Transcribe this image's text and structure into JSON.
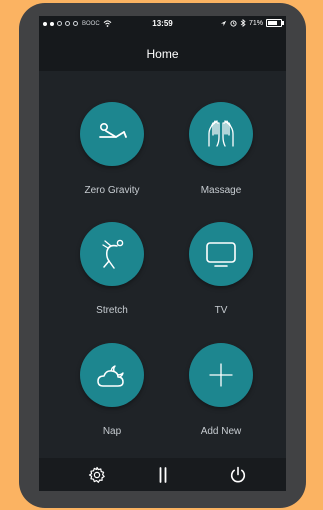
{
  "status_bar": {
    "time": "13:59",
    "battery": "71%",
    "carrier": "BOOC"
  },
  "nav": {
    "title": "Home"
  },
  "tiles": [
    {
      "label": "Zero Gravity",
      "icon": "recline-person-icon"
    },
    {
      "label": "Massage",
      "icon": "massage-hands-icon"
    },
    {
      "label": "Stretch",
      "icon": "stretch-person-icon"
    },
    {
      "label": "TV",
      "icon": "tv-icon"
    },
    {
      "label": "Nap",
      "icon": "cloud-moon-icon"
    },
    {
      "label": "Add New",
      "icon": "plus-icon"
    }
  ],
  "tab_bar": {
    "items": [
      "gear-icon",
      "pause-icon",
      "power-icon"
    ]
  },
  "colors": {
    "accent": "#1d868f",
    "background": "#1f2327",
    "frame": "#414244",
    "page": "#fbb362"
  }
}
